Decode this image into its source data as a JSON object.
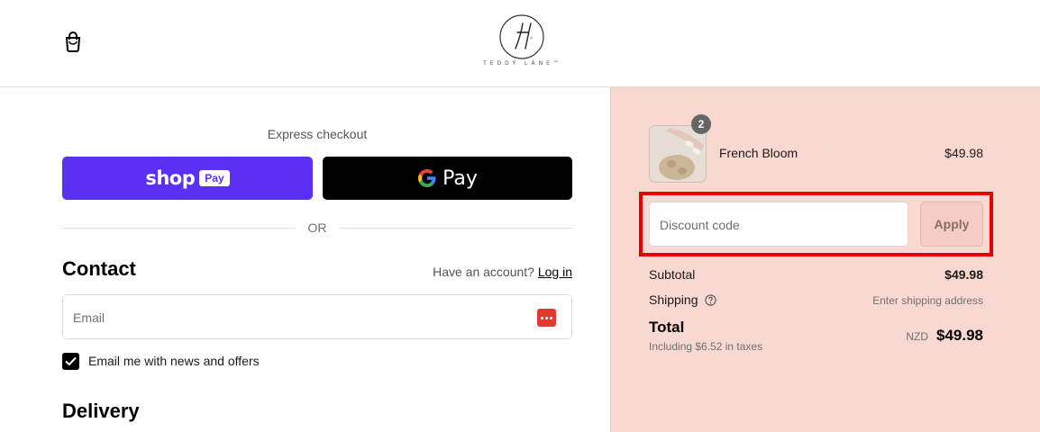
{
  "header": {
    "brand_text": "TEDDY LANE™"
  },
  "express": {
    "title": "Express checkout",
    "shop_word": "shop",
    "shop_badge": "Pay",
    "gpay_text": "Pay",
    "or_text": "OR"
  },
  "contact": {
    "title": "Contact",
    "account_prompt": "Have an account?",
    "login_label": "Log in",
    "email_placeholder": "Email",
    "newsletter_label": "Email me with news and offers",
    "newsletter_checked": true
  },
  "delivery": {
    "title": "Delivery"
  },
  "summary": {
    "item": {
      "name": "French Bloom",
      "price": "$49.98",
      "quantity": "2"
    },
    "discount_placeholder": "Discount code",
    "apply_label": "Apply",
    "subtotal_label": "Subtotal",
    "subtotal_value": "$49.98",
    "shipping_label": "Shipping",
    "shipping_value": "Enter shipping address",
    "total_label": "Total",
    "tax_note": "Including $6.52 in taxes",
    "currency": "NZD",
    "total_value": "$49.98"
  },
  "colors": {
    "shop_pay_purple": "#5a31f4",
    "summary_background": "#f9d8d1",
    "highlight_red": "#e60000"
  },
  "icons": [
    "shopping-bag-icon",
    "brand-logo",
    "google-g-icon",
    "password-manager-icon",
    "checkmark-icon",
    "help-circle-icon"
  ]
}
